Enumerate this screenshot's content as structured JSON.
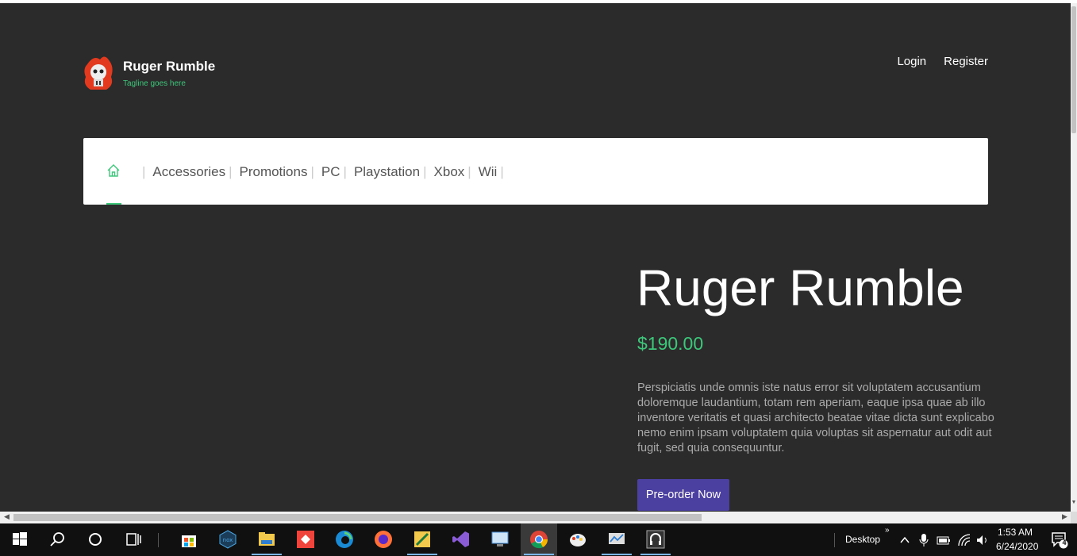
{
  "header": {
    "brand": "Ruger Rumble",
    "tagline": "Tagline goes here",
    "login": "Login",
    "register": "Register"
  },
  "nav": {
    "items": [
      "Accessories",
      "Promotions",
      "PC",
      "Playstation",
      "Xbox",
      "Wii"
    ]
  },
  "product": {
    "title": "Ruger Rumble",
    "price": "$190.00",
    "description": "Perspiciatis unde omnis iste natus error sit voluptatem accusantium doloremque laudantium, totam rem aperiam, eaque ipsa quae ab illo inventore veritatis et quasi architecto beatae vitae dicta sunt explicabo nemo enim ipsam voluptatem quia voluptas sit aspernatur aut odit aut fugit, sed quia consequuntur.",
    "cta": "Pre-order Now"
  },
  "colors": {
    "page_bg": "#2b2b2b",
    "accent_green": "#3ec77b",
    "button_purple": "#4b3fa0"
  },
  "taskbar": {
    "desktop_label": "Desktop",
    "time": "1:53 AM",
    "date": "6/24/2020",
    "notifications": "4",
    "icons": [
      "windows-start-icon",
      "search-icon",
      "cortana-icon",
      "task-view-icon",
      "store-icon",
      "nox-icon",
      "file-explorer-icon",
      "anydesk-icon",
      "edge-icon",
      "firefox-icon",
      "app-icon",
      "visual-studio-icon",
      "remote-desktop-icon",
      "chrome-icon",
      "paint-icon",
      "monitor-app-icon",
      "headset-app-icon"
    ]
  }
}
